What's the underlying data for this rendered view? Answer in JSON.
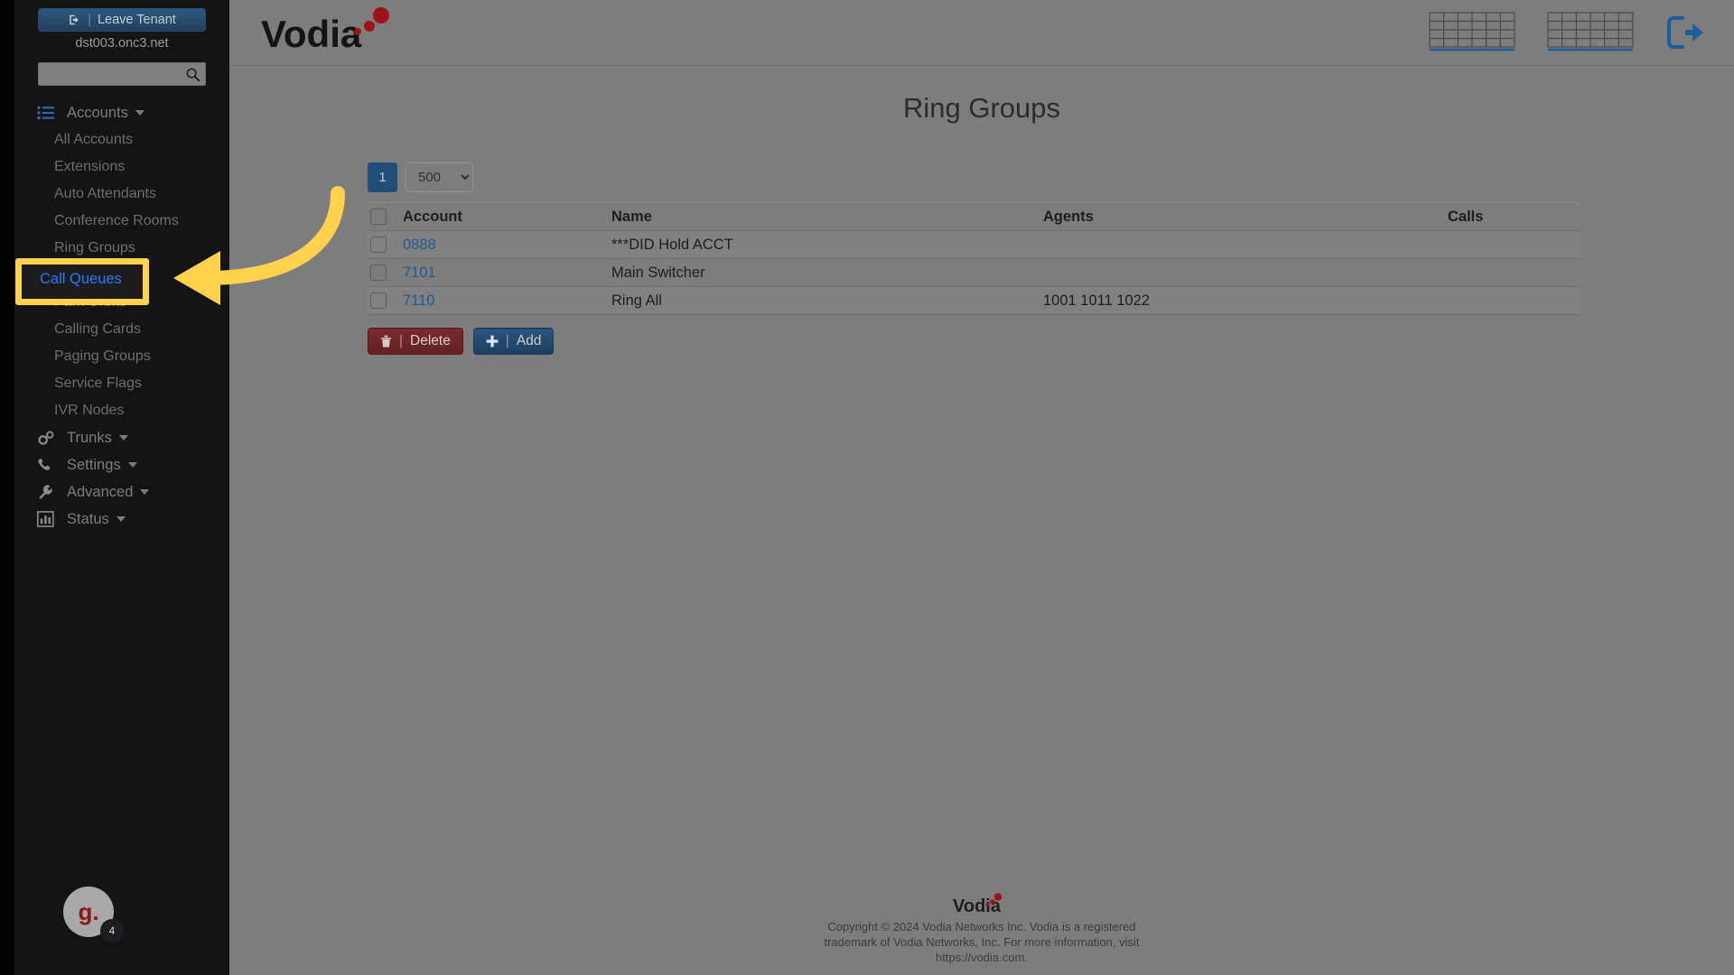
{
  "sidebar": {
    "leave_tenant": {
      "label": "Leave Tenant",
      "separator": "|",
      "icon": "leave-tenant-icon"
    },
    "tenant_name": "dst003.onc3.net",
    "search": {
      "value": "",
      "placeholder": "",
      "icon": "search-icon"
    },
    "nav": [
      {
        "type": "group",
        "label": "Accounts",
        "icon": "list-icon",
        "expanded": true
      },
      {
        "type": "sub",
        "label": "All Accounts",
        "active": false
      },
      {
        "type": "sub",
        "label": "Extensions",
        "active": false
      },
      {
        "type": "sub",
        "label": "Auto Attendants",
        "active": false
      },
      {
        "type": "sub",
        "label": "Conference Rooms",
        "active": false
      },
      {
        "type": "sub",
        "label": "Ring Groups",
        "active": false
      },
      {
        "type": "sub",
        "label": "Call Queues",
        "active": true
      },
      {
        "type": "sub",
        "label": "Park Orbits",
        "active": false
      },
      {
        "type": "sub",
        "label": "Calling Cards",
        "active": false
      },
      {
        "type": "sub",
        "label": "Paging Groups",
        "active": false
      },
      {
        "type": "sub",
        "label": "Service Flags",
        "active": false
      },
      {
        "type": "sub",
        "label": "IVR Nodes",
        "active": false
      },
      {
        "type": "group",
        "label": "Trunks",
        "icon": "gears-icon",
        "expanded": false
      },
      {
        "type": "group",
        "label": "Settings",
        "icon": "phone-icon",
        "expanded": false
      },
      {
        "type": "group",
        "label": "Advanced",
        "icon": "wrench-icon",
        "expanded": false
      },
      {
        "type": "group",
        "label": "Status",
        "icon": "bar-chart-icon",
        "expanded": false
      }
    ],
    "avatar": {
      "initials": "g.",
      "badge": "4"
    }
  },
  "header": {
    "logo_text": "Vodia",
    "icons": [
      "grid-icon",
      "grid-icon",
      "logout-icon"
    ]
  },
  "main": {
    "page_title": "Ring Groups",
    "toolbar": {
      "page_number": "1",
      "page_size_selected": "500",
      "page_size_options": [
        "500"
      ]
    },
    "table": {
      "columns": [
        "",
        "Account",
        "Name",
        "Agents",
        "Calls"
      ],
      "rows": [
        {
          "checked": false,
          "account": "0888",
          "name": "***DID Hold ACCT",
          "agents": "",
          "calls": ""
        },
        {
          "checked": false,
          "account": "7101",
          "name": "Main Switcher",
          "agents": "",
          "calls": ""
        },
        {
          "checked": false,
          "account": "7110",
          "name": "Ring All",
          "agents": "1001 1011 1022",
          "calls": ""
        }
      ]
    },
    "actions": {
      "delete_label": "Delete",
      "add_label": "Add",
      "separator": "|"
    }
  },
  "footer": {
    "logo_text": "Vodia",
    "line1": "Copyright © 2024 Vodia Networks Inc. Vodia is a registered",
    "line2": "trademark of Vodia Networks, Inc. For more information, visit",
    "line3": "https://vodia.com."
  },
  "annotation": {
    "highlight_label": "Call Queues",
    "highlight_color": "#ffd24d",
    "arrow": "curved-left-arrow"
  }
}
